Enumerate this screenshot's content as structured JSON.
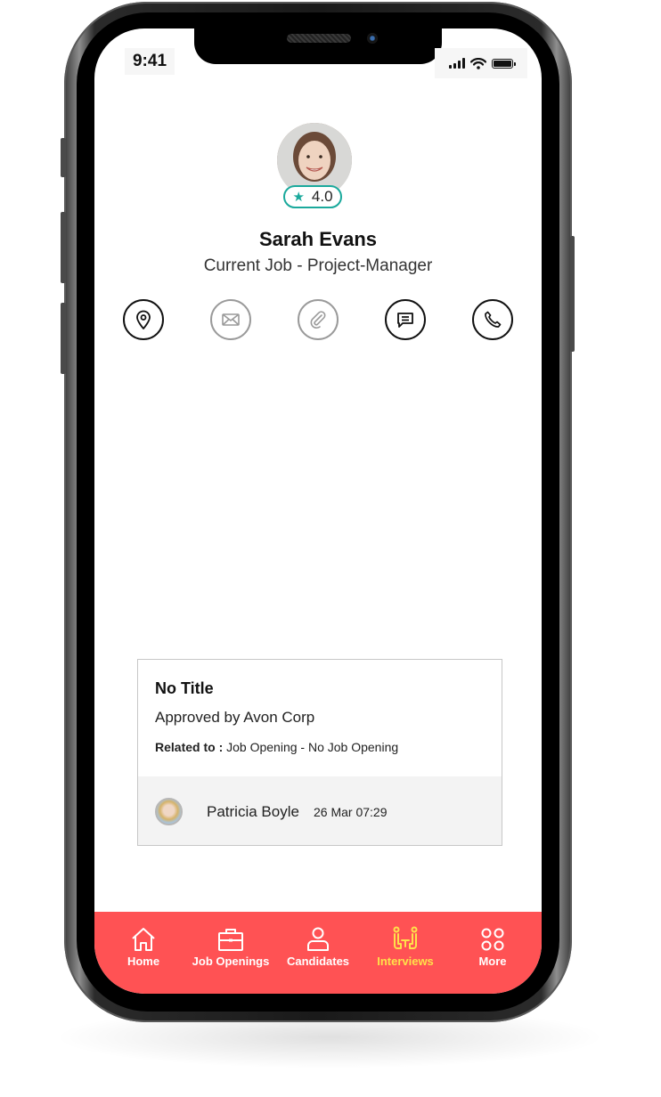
{
  "status_bar": {
    "time": "9:41"
  },
  "profile": {
    "name": "Sarah Evans",
    "subtitle": "Current Job - Project-Manager",
    "rating": "4.0",
    "rating_color": "#1aa99c"
  },
  "actions": [
    {
      "icon": "location-pin-icon",
      "enabled": true
    },
    {
      "icon": "mail-icon",
      "enabled": false
    },
    {
      "icon": "paperclip-icon",
      "enabled": false
    },
    {
      "icon": "chat-icon",
      "enabled": true
    },
    {
      "icon": "phone-icon",
      "enabled": true
    }
  ],
  "card": {
    "title": "No Title",
    "approved": "Approved by Avon Corp",
    "related_label": "Related to :",
    "related_value": "Job Opening - No Job Opening",
    "footer": {
      "name": "Patricia Boyle",
      "date": "26 Mar 07:29"
    }
  },
  "tabbar": {
    "background": "#ff5254",
    "active_color": "#ffe14a",
    "items": [
      {
        "label": "Home",
        "icon": "home-icon"
      },
      {
        "label": "Job Openings",
        "icon": "briefcase-icon"
      },
      {
        "label": "Candidates",
        "icon": "person-icon"
      },
      {
        "label": "Interviews",
        "icon": "interviews-icon",
        "active": true
      },
      {
        "label": "More",
        "icon": "more-grid-icon"
      }
    ]
  }
}
